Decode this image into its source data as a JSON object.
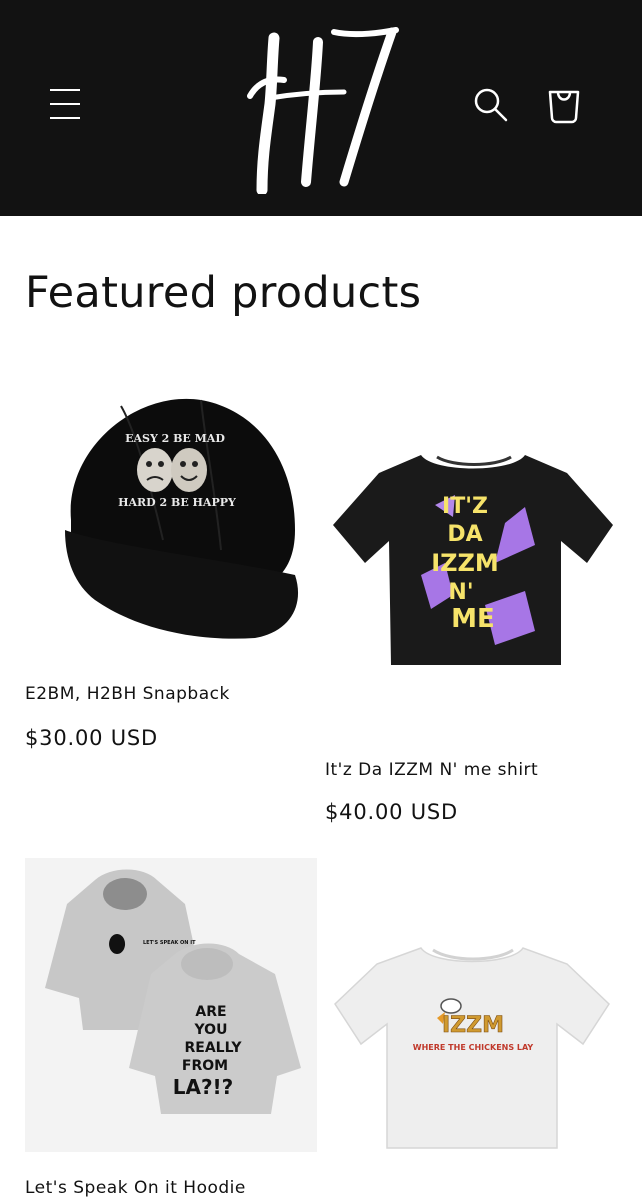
{
  "header": {
    "menu_icon": "hamburger-menu-icon",
    "logo_text": "H7",
    "search_icon": "search-icon",
    "cart_icon": "cart-bag-icon",
    "colors": {
      "background": "#121212",
      "foreground": "#ffffff"
    }
  },
  "featured": {
    "title": "Featured products",
    "products": [
      {
        "name": "E2BM, H2BH Snapback",
        "price": "$30.00 USD",
        "image_text_top": "EASY 2 BE MAD",
        "image_text_bottom": "HARD 2 BE HAPPY"
      },
      {
        "name": "It'z Da IZZM N' me shirt",
        "price": "$40.00 USD",
        "image_lines": [
          "IT'Z",
          "DA",
          "IZZM",
          "N'",
          "ME"
        ]
      },
      {
        "name": "Let's Speak On it Hoodie",
        "image_lines": [
          "ARE",
          "YOU",
          "REALLY",
          "FROM",
          "LA?!?"
        ],
        "image_chest_text": "LET'S SPEAK ON IT"
      },
      {
        "image_logo": "IZZM",
        "image_caption": "WHERE THE CHICKENS LAY"
      }
    ]
  }
}
